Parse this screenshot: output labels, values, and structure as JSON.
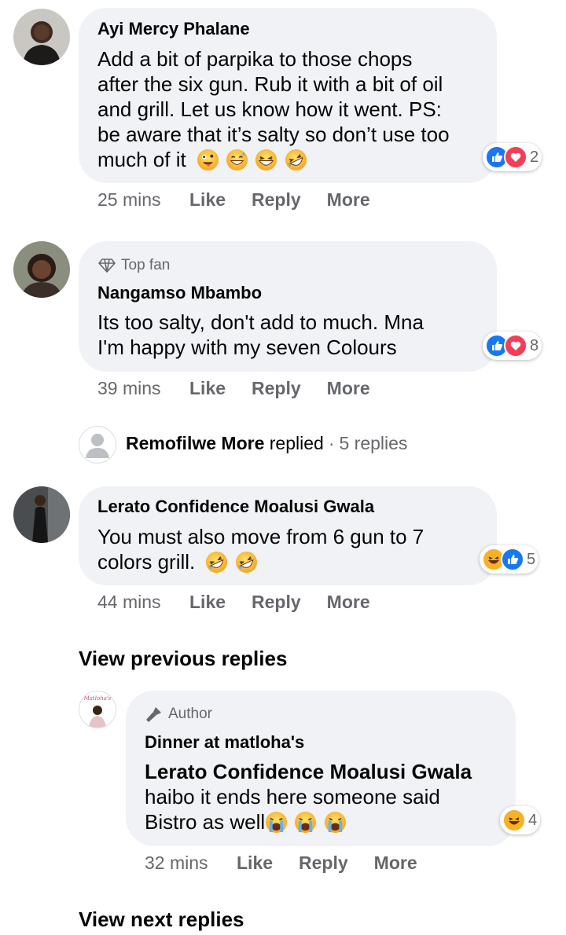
{
  "comments": [
    {
      "author": "Ayi Mercy Phalane",
      "text": "Add a bit of parpika to those chops after the six gun. Rub it with a bit of oil and grill. Let us know how it went. PS: be aware that it’s salty so don’t use too much of it",
      "line1": "Add a bit of parpika to those chops",
      "line2": "after the six gun. Rub it with a bit of oil",
      "line3": "and grill. Let us know how it went. PS:",
      "line4": "be aware that it’s salty so don’t use too",
      "line5": "much of it",
      "emojis": [
        "zany-face-emoji",
        "grinning-sweat-emoji",
        "laughing-emoji",
        "rolling-laughing-emoji"
      ],
      "reactions": {
        "types": [
          "like-icon",
          "love-icon"
        ],
        "count": "2"
      },
      "time": "25 mins",
      "like": "Like",
      "reply": "Reply",
      "more": "More"
    },
    {
      "badge": "Top fan",
      "author": "Nangamso Mbambo",
      "line1": "Its too salty, don't add to much. Mna",
      "line2": "I'm happy with my seven Colours",
      "reactions": {
        "types": [
          "like-icon",
          "love-icon"
        ],
        "count": "8"
      },
      "time": "39 mins",
      "like": "Like",
      "reply": "Reply",
      "more": "More"
    },
    {
      "author": "Lerato Confidence Moalusi Gwala",
      "line1": "You must also move from 6 gun to 7",
      "line2": "colors grill.",
      "emojis": [
        "rolling-laughing-emoji",
        "rolling-laughing-emoji"
      ],
      "reactions": {
        "types": [
          "haha-icon",
          "like-icon"
        ],
        "count": "5"
      },
      "time": "44 mins",
      "like": "Like",
      "reply": "Reply",
      "more": "More"
    }
  ],
  "replies_summary": {
    "name": "Remofilwe More",
    "action": "replied",
    "separator": "·",
    "count": "5 replies"
  },
  "view_previous": "View previous replies",
  "author_reply": {
    "badge": "Author",
    "author": "Dinner at matloha's",
    "avatar_text": "Matloha's",
    "mention": "Lerato Confidence Moalusi Gwala",
    "line1": "haibo it ends here someone said",
    "line2": "Bistro as well",
    "emojis": [
      "crying-emoji",
      "crying-emoji",
      "crying-emoji"
    ],
    "reactions": {
      "types": [
        "haha-icon"
      ],
      "count": "4"
    },
    "time": "32 mins",
    "like": "Like",
    "reply": "Reply",
    "more": "More"
  },
  "view_next": "View next replies",
  "colors": {
    "bubble": "#f0f2f5",
    "secondary_text": "#65676b",
    "like_blue": "#1877f2",
    "love_red": "#f33e58",
    "haha_yellow": "#f7b125"
  }
}
